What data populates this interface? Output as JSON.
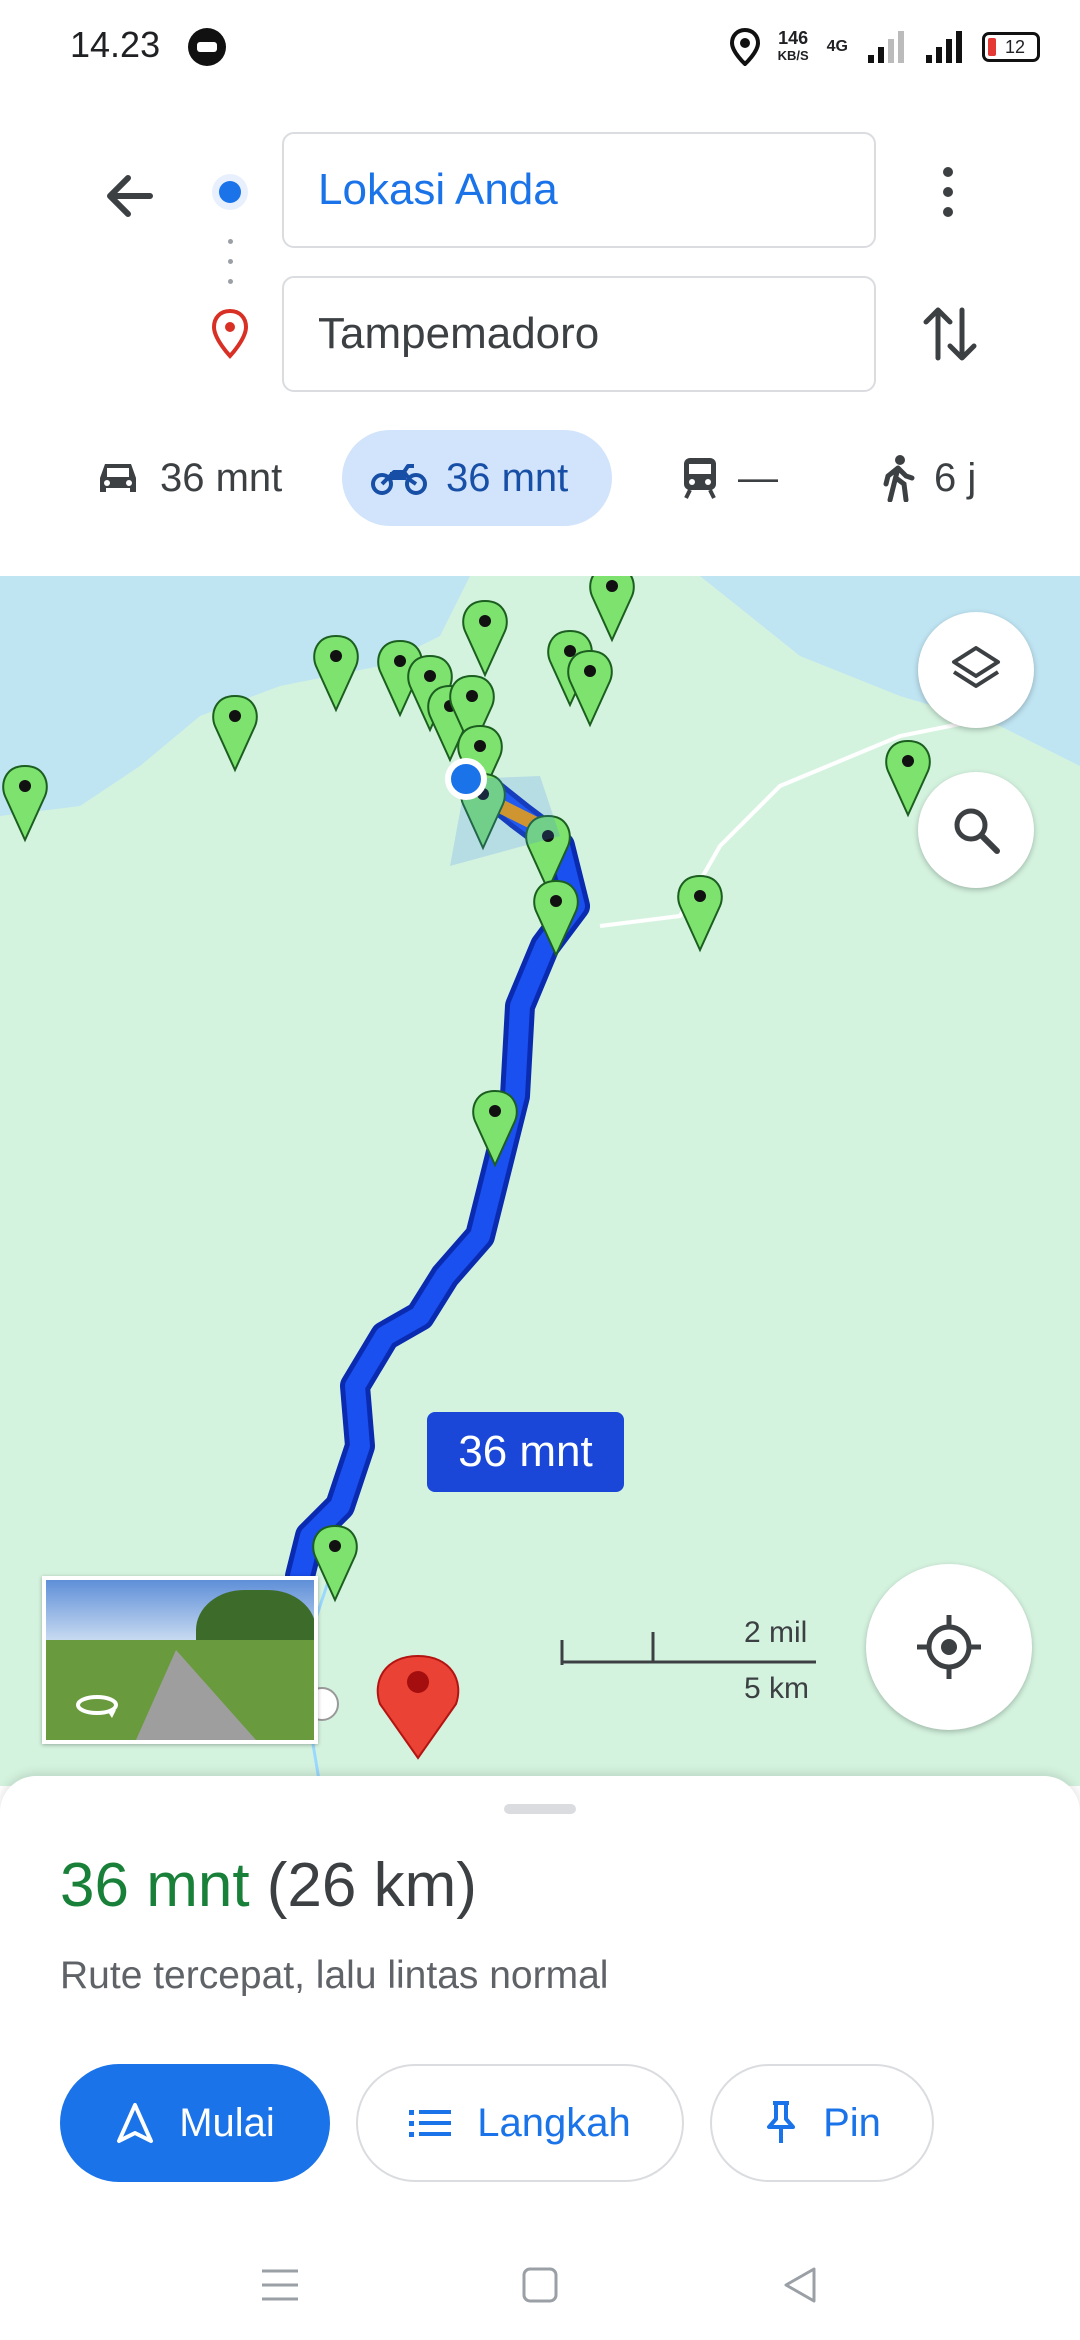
{
  "status": {
    "time": "14.23",
    "net_speed_value": "146",
    "net_speed_unit": "KB/S",
    "network": "4G",
    "battery": "12"
  },
  "directions": {
    "origin": "Lokasi Anda",
    "destination": "Tampemadoro"
  },
  "modes": [
    {
      "icon": "car-icon",
      "label": "36 mnt",
      "active": false
    },
    {
      "icon": "motorcycle-icon",
      "label": "36 mnt",
      "active": true
    },
    {
      "icon": "train-icon",
      "label": "—",
      "active": false
    },
    {
      "icon": "walk-icon",
      "label": "6 j",
      "active": false
    }
  ],
  "map": {
    "route_time_label": "36 mnt",
    "scale_imperial": "2 mil",
    "scale_metric": "5 km",
    "colors": {
      "land": "#d4f3df",
      "water": "#bfe4f2",
      "route": "#1a3fe0",
      "pin_green": "#7ee26e",
      "destination_pin": "#ea4335"
    }
  },
  "summary": {
    "duration": "36 mnt",
    "distance": "(26 km)",
    "description": "Rute tercepat, lalu lintas normal"
  },
  "actions": {
    "start": "Mulai",
    "steps": "Langkah",
    "pin": "Pin"
  }
}
